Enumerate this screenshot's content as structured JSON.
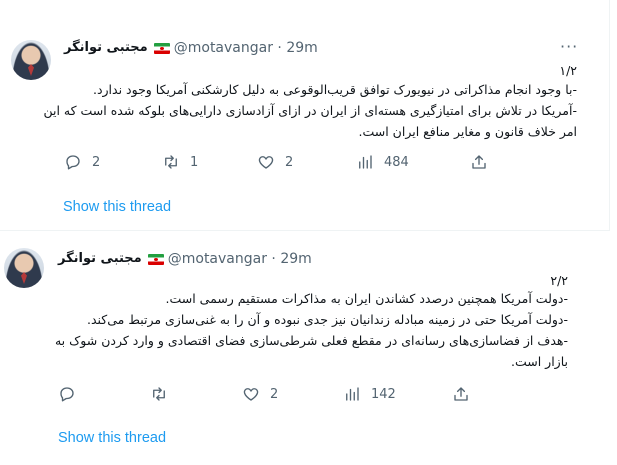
{
  "tweets": [
    {
      "author_name": "مجتبی توانگر",
      "handle_time": "@motavangar · 29m",
      "more": "···",
      "lines": [
        "۱/۲",
        "-با وجود انجام مذاکراتی در نیویورک توافق قریب‌الوقوعی به دلیل کارشکنی آمریکا وجود ندارد.",
        "-آمریکا در تلاش برای امتیازگیری هسته‌ای از ایران در ازای آزادسازی دارایی‌های بلوکه شده است که این",
        "امر خلاف قانون و مغایر منافع ایران است."
      ],
      "reply_count": "2",
      "retweet_count": "1",
      "like_count": "2",
      "views_count": "484",
      "show_thread": "Show this thread"
    },
    {
      "author_name": "مجتبی توانگر",
      "handle_time": "@motavangar · 29m",
      "more": "···",
      "lines": [
        "۲/۲",
        "-دولت آمریکا همچنین درصدد کشاندن ایران به مذاکرات مستقیم رسمی است.",
        "-دولت آمریکا حتی در زمینه مبادله زندانیان نیز جدی نبوده و آن را به غنی‌سازی مرتبط می‌کند.",
        "-هدف از فضاسازی‌های رسانه‌ای در مقطع فعلی شرطی‌سازی فضای اقتصادی و وارد کردن شوک به",
        "بازار است."
      ],
      "reply_count": "",
      "retweet_count": "",
      "like_count": "2",
      "views_count": "142",
      "show_thread": "Show this thread"
    }
  ]
}
